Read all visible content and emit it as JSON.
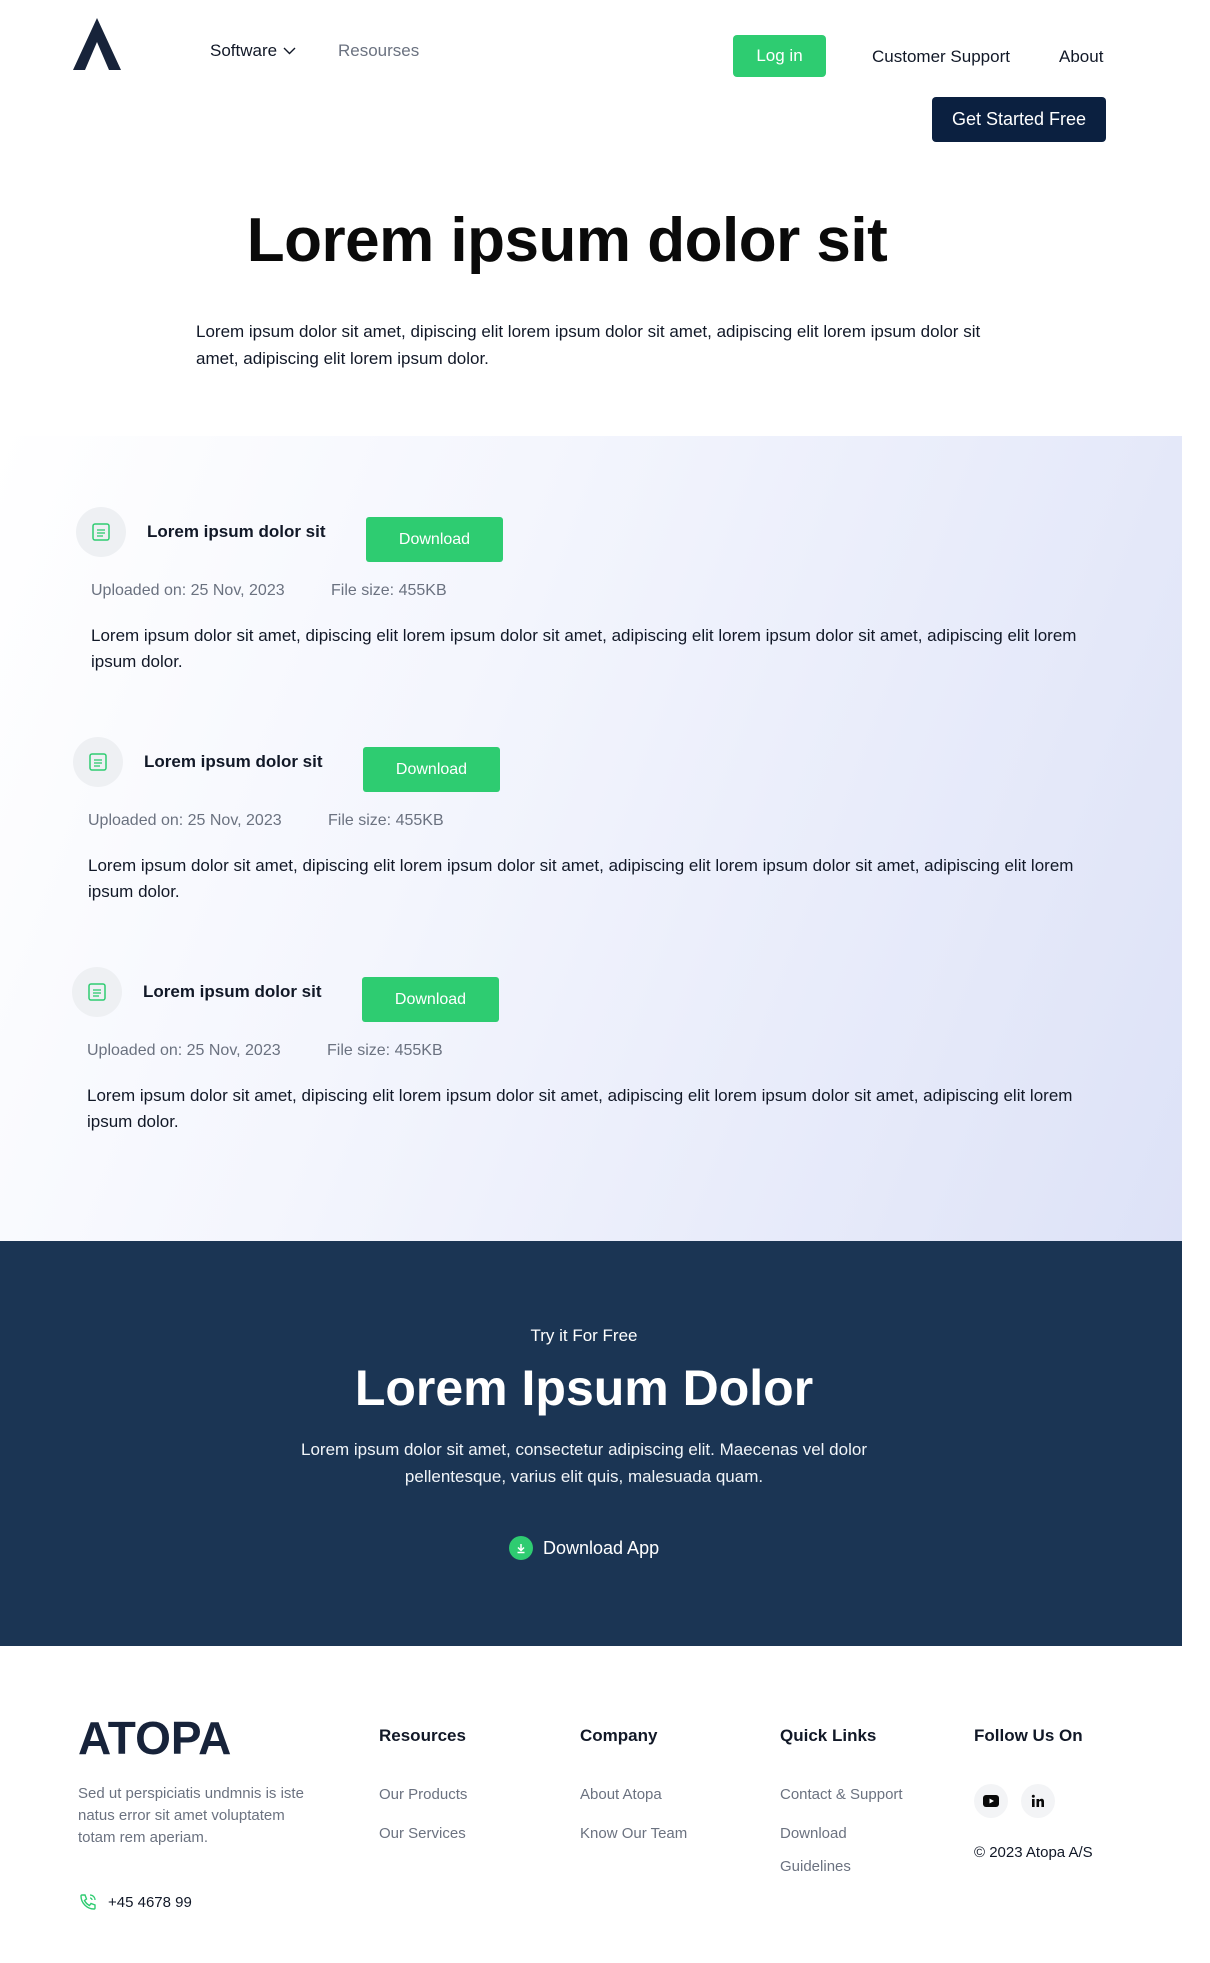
{
  "header": {
    "nav": {
      "software": "Software",
      "resources": "Resourses",
      "login": "Log in",
      "support": "Customer Support",
      "about": "About",
      "get_started": "Get Started Free"
    }
  },
  "hero": {
    "title": "Lorem ipsum dolor sit",
    "text": "Lorem ipsum dolor sit amet, dipiscing elit lorem ipsum dolor sit amet, adipiscing elit lorem ipsum dolor sit amet, adipiscing elit lorem ipsum dolor."
  },
  "files": [
    {
      "name": "Lorem ipsum dolor sit",
      "download_label": "Download",
      "uploaded": "Uploaded on: 25 Nov, 2023",
      "size": "File size: 455KB",
      "description": "Lorem ipsum dolor sit amet, dipiscing elit lorem ipsum dolor sit amet, adipiscing elit lorem ipsum dolor sit amet, adipiscing elit lorem ipsum dolor."
    },
    {
      "name": "Lorem ipsum dolor sit",
      "download_label": "Download",
      "uploaded": "Uploaded on: 25 Nov, 2023",
      "size": "File size: 455KB",
      "description": "Lorem ipsum dolor sit amet, dipiscing elit lorem ipsum dolor sit amet, adipiscing elit lorem ipsum dolor sit amet, adipiscing elit lorem ipsum dolor."
    },
    {
      "name": "Lorem ipsum dolor sit",
      "download_label": "Download",
      "uploaded": "Uploaded on: 25 Nov, 2023",
      "size": "File size: 455KB",
      "description": "Lorem ipsum dolor sit amet, dipiscing elit lorem ipsum dolor sit amet, adipiscing elit lorem ipsum dolor sit amet, adipiscing elit lorem ipsum dolor."
    }
  ],
  "cta": {
    "kicker": "Try it For Free",
    "title": "Lorem Ipsum Dolor",
    "text": "Lorem ipsum dolor sit amet, consectetur adipiscing elit. Maecenas vel dolor pellentesque, varius elit quis, malesuada quam.",
    "download_app": "Download App"
  },
  "footer": {
    "brand": "ATOPA",
    "description": "Sed ut perspiciatis undmnis is iste natus error sit amet voluptatem totam rem aperiam.",
    "phone": "+45 4678 99",
    "columns": {
      "resources": {
        "title": "Resources",
        "links": [
          "Our Products",
          "Our Services"
        ]
      },
      "company": {
        "title": "Company",
        "links": [
          "About Atopa",
          "Know Our Team"
        ]
      },
      "quick_links": {
        "title": "Quick Links",
        "links": [
          "Contact & Support",
          "Download",
          "Guidelines"
        ]
      },
      "follow": {
        "title": "Follow Us On"
      }
    },
    "copyright": "© 2023 Atopa A/S"
  },
  "icons": {
    "file": "file-icon",
    "chevron": "chevron-down-icon",
    "download": "download-icon",
    "phone": "phone-icon",
    "youtube": "youtube-icon",
    "linkedin": "linkedin-icon"
  },
  "colors": {
    "accent": "#2ecc71",
    "navy": "#0b2040",
    "cta_bg": "#1b3554"
  }
}
